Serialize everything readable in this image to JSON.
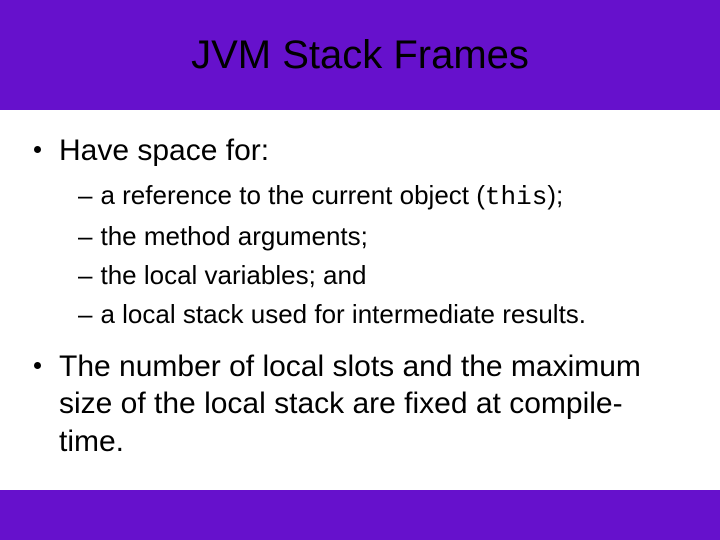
{
  "title": "JVM Stack Frames",
  "main1": "Have space for:",
  "sub1_pre": "a reference to the current object (",
  "sub1_code": "this",
  "sub1_post": ");",
  "sub2": "the method arguments;",
  "sub3": "the local variables; and",
  "sub4": "a local stack used for intermediate results.",
  "main2": "The number of local slots and the maximum size of the local stack are fixed at compile-time."
}
